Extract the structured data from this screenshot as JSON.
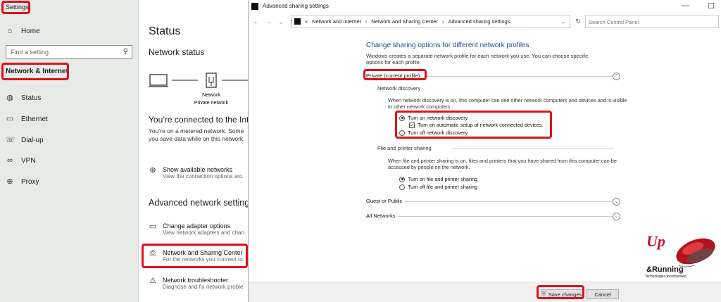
{
  "settings": {
    "window_title": "Settings",
    "home": "Home",
    "search_placeholder": "Find a setting",
    "section": "Network & Internet",
    "items": [
      {
        "label": "Status",
        "icon": "globe-status-icon"
      },
      {
        "label": "Ethernet",
        "icon": "ethernet-icon"
      },
      {
        "label": "Dial-up",
        "icon": "phone-icon"
      },
      {
        "label": "VPN",
        "icon": "vpn-icon"
      },
      {
        "label": "Proxy",
        "icon": "globe-icon"
      }
    ]
  },
  "status": {
    "title": "Status",
    "subtitle": "Network status",
    "diagram_label_1": "Network",
    "diagram_label_2": "Private network",
    "connected": "You’re connected to the Inte",
    "metered_1": "You’re on a metered network. Some",
    "metered_2": "you save data while on this network.",
    "show_networks_title": "Show available networks",
    "show_networks_desc": "View the connection options aro",
    "advanced_heading": "Advanced network setting",
    "links": [
      {
        "title": "Change adapter options",
        "desc": "View network adapters and chan"
      },
      {
        "title": "Network and Sharing Center",
        "desc": "For the networks you connect to"
      },
      {
        "title": "Network troubleshooter",
        "desc": "Diagnose and fix network proble"
      }
    ]
  },
  "window": {
    "title": "Advanced sharing settings",
    "breadcrumb": [
      "«",
      "Network and Internet",
      "›",
      "Network and Sharing Center",
      "›",
      "Advanced sharing settings"
    ],
    "search_placeholder": "Search Control Panel",
    "heading": "Change sharing options for different network profiles",
    "intro": "Windows creates a separate network profile for each network you use. You can choose specific options for each profile.",
    "private_profile": "Private (current profile)",
    "network_discovery": "Network discovery",
    "nd_desc": "When network discovery is on, this computer can see other network computers and devices and is visible to other network computers.",
    "nd_on": "Turn on network discovery",
    "nd_auto": "Turn on automatic setup of network connected devices.",
    "nd_off": "Turn off network discovery",
    "fps": "File and printer sharing",
    "fps_desc": "When file and printer sharing is on, files and printers that you have shared from this computer can be accessed by people on the network.",
    "fps_on": "Turn on file and printer sharing",
    "fps_off": "Turn off file and printer sharing",
    "guest": "Guest or Public",
    "all": "All Networks",
    "save": "Save changes",
    "cancel": "Cancel"
  },
  "watermark": {
    "up": "Up",
    "running": "&Running",
    "tagline": "Technologies Incorporated"
  }
}
